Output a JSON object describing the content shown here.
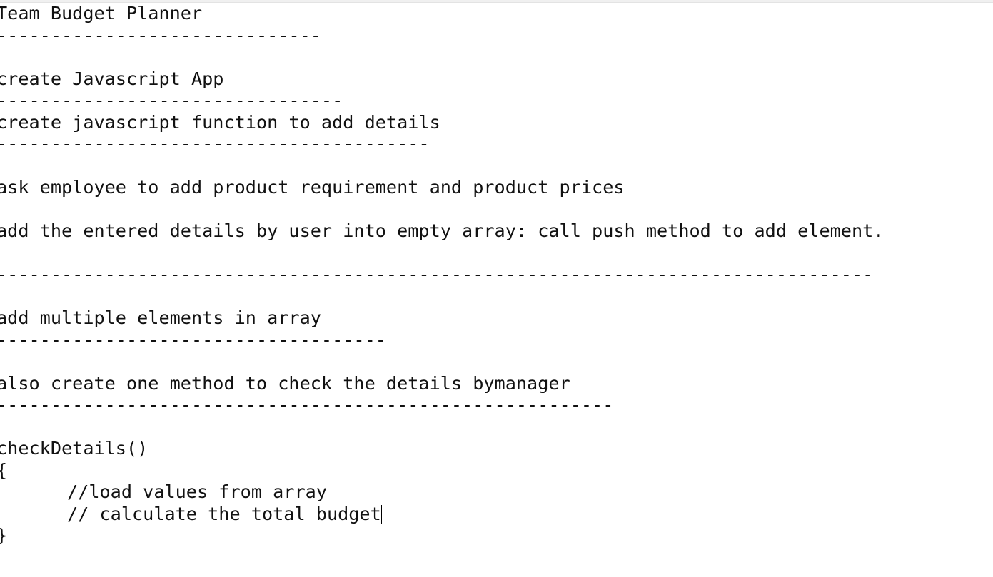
{
  "document": {
    "lines": [
      "Team Budget Planner",
      "------------------------------",
      "",
      "create Javascript App",
      "--------------------------------",
      "create javascript function to add details",
      "----------------------------------------",
      "",
      "ask employee to add product requirement and product prices",
      "",
      "add the entered details by user into empty array: call push method to add element.",
      "",
      "---------------------------------------------------------------------------------",
      "",
      "add multiple elements in array",
      "------------------------------------",
      "",
      "also create one method to check the details bymanager",
      "---------------------------------------------------------",
      "",
      "checkDetails()",
      "{",
      "//load values from array",
      "// calculate the total budget",
      "}"
    ]
  }
}
